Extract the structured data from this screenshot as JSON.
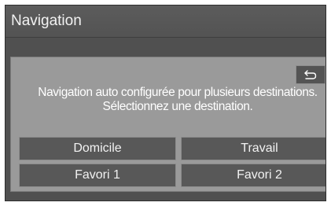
{
  "header": {
    "title": "Navigation"
  },
  "dialog": {
    "message_line1": "Navigation auto configurée pour plusieurs destinations.",
    "message_line2": "Sélectionnez une destination.",
    "back_icon": "return-arrow-icon",
    "buttons": [
      {
        "label": "Domicile"
      },
      {
        "label": "Travail"
      },
      {
        "label": "Favori 1"
      },
      {
        "label": "Favori 2"
      }
    ]
  },
  "colors": {
    "screen_bg": "#505050",
    "dialog_bg": "#9a9a9a",
    "button_bg": "#585858",
    "text": "#ffffff"
  }
}
